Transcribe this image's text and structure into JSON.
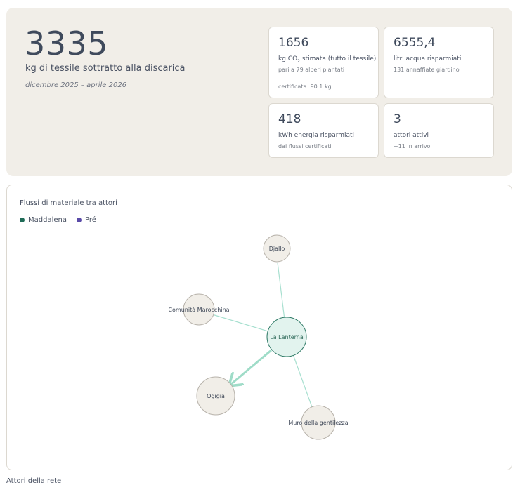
{
  "hero": {
    "total_value": "3335",
    "total_label": "kg di tessile sottratto alla discarica",
    "period": "dicembre 2025 – aprile 2026"
  },
  "stats": {
    "co2": {
      "value": "1656",
      "label_main": "kg CO",
      "label_sub": "2",
      "label_rest": " stimata (tutto il tessile)",
      "sub": "pari a 79 alberi piantati",
      "certified": "certificata: 90.1 kg"
    },
    "water": {
      "value": "6555,4",
      "label": "litri acqua risparmiati",
      "sub": "131 annaffiate giardino"
    },
    "energy": {
      "value": "418",
      "label": "kWh energia risparmiati",
      "sub": "dai flussi certificati"
    },
    "actors": {
      "value": "3",
      "label": "attori attivi",
      "sub": "+11 in arrivo"
    }
  },
  "graph": {
    "title": "Flussi di materiale tra attori",
    "legend": [
      {
        "label": "Maddalena",
        "color": "#1f6b57"
      },
      {
        "label": "Pré",
        "color": "#5a4aa8"
      }
    ],
    "nodes": {
      "center": "La Lanterna",
      "djallo": "Djallo",
      "comunita": "Comunità Marocchina",
      "ogigia": "Ogigia",
      "muro": "Muro della gentilezza"
    },
    "colors": {
      "edge": "#a8e0d0",
      "edge_strong": "#9fdcc8",
      "center_fill": "#e2f3ee",
      "center_stroke": "#2f7a66",
      "node_fill": "#f1eee8",
      "node_stroke": "#b7b2aa"
    }
  },
  "next_section": {
    "title": "Attori della rete"
  }
}
